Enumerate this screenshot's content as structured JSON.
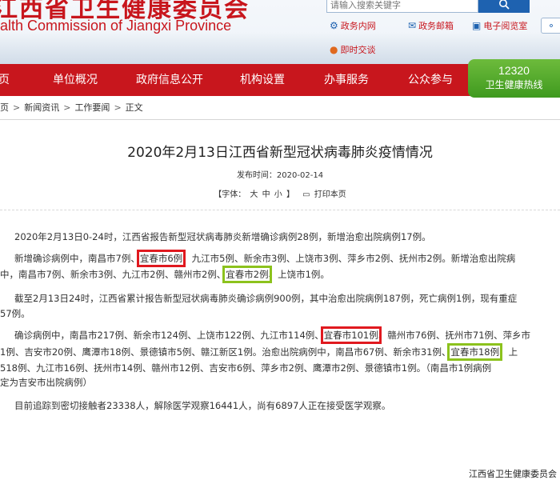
{
  "header": {
    "title_cn": "江西省卫生健康委员会",
    "title_en": "alth Commission of Jiangxi Province",
    "search_placeholder": "请输入搜索关键字",
    "links": {
      "gov_intranet": "政务内网",
      "gov_mail": "政务邮箱",
      "e_reading": "电子阅览室",
      "instant_chat": "即时交谈"
    }
  },
  "nav": {
    "items": [
      "页",
      "单位概况",
      "政府信息公开",
      "机构设置",
      "办事服务",
      "公众参与"
    ],
    "hotline_number": "12320",
    "hotline_label": "卫生健康热线"
  },
  "breadcrumb": {
    "items": [
      "页",
      "新闻资讯",
      "工作要闻",
      "正文"
    ]
  },
  "article": {
    "title": "2020年2月13日江西省新型冠状病毒肺炎疫情情况",
    "publish_time": "发布时间：2020-02-14",
    "font_size_label": "【字体：",
    "font_large": "大",
    "font_medium": "中",
    "font_small": "小",
    "font_size_close": "】",
    "print": "打印本页",
    "lines": [
      [
        "2020年2月13日0-24时，江西省报告新型冠状病毒肺炎新增确诊病例28例，新增治愈出院病例17例。"
      ],
      [
        "新增确诊病例中，南昌市7例、",
        "宜春市6例",
        "、九江市5例、新余市3例、上饶市3例、萍乡市2例、抚州市2例。新增治愈出院病"
      ],
      [
        "中，南昌市7例、新余市3例、九江市2例、赣州市2例、",
        "宜春市2例",
        "、上饶市1例。"
      ],
      [
        "截至2月13日24时，江西省累计报告新型冠状病毒肺炎确诊病例900例，其中治愈出院病例187例，死亡病例1例，现有重症"
      ],
      [
        "57例。"
      ],
      [
        "确诊病例中，南昌市217例、新余市124例、上饶市122例、九江市114例、",
        "宜春市101例",
        "、赣州市76例、抚州市71例、萍乡市"
      ],
      [
        "1例、吉安市20例、鹰潭市18例、景德镇市5例、赣江新区1例。治愈出院病例中，南昌市67例、新余市31例、",
        "宜春市18例",
        "、上"
      ],
      [
        "518例、九江市16例、抚州市14例、赣州市12例、吉安市6例、萍乡市2例、鹰潭市2例、景德镇市1例。（南昌市1例病例"
      ],
      [
        "定为吉安市出院病例）"
      ],
      [
        "目前追踪到密切接触者23338人，解除医学观察16441人，尚有6897人正在接受医学观察。"
      ]
    ],
    "signature": "江西省卫生健康委员会"
  },
  "colors": {
    "brand_red": "#c8161d",
    "nav_red": "#c8161d",
    "hotline_green": "#4fa726",
    "highlight_red": "#e0191f",
    "highlight_green": "#8cc21d"
  },
  "icons": {
    "search": "search-icon",
    "gov_intranet": "network-icon",
    "gov_mail": "mail-icon",
    "e_reading": "monitor-icon",
    "instant_chat": "chat-icon"
  }
}
